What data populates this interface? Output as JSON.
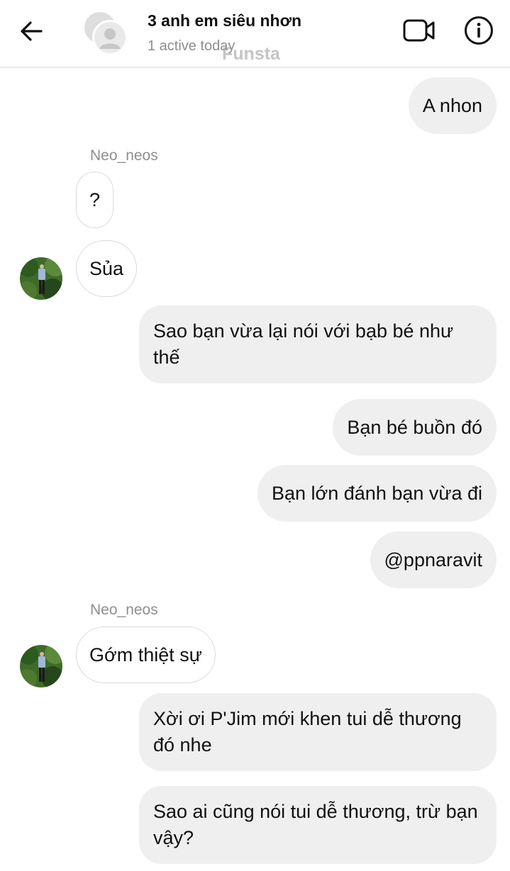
{
  "header": {
    "title": "3 anh em siêu nhơn",
    "status": "1 active today",
    "watermark": "Funsta",
    "icons": {
      "back": "arrow-left-icon",
      "video": "video-camera-icon",
      "info": "info-circle-icon"
    }
  },
  "messages": [
    {
      "direction": "outgoing",
      "text": "A nhon"
    },
    {
      "direction": "incoming",
      "sender": "Neo_neos",
      "text": "?"
    },
    {
      "direction": "incoming",
      "text": "Sủa",
      "avatar": "user-photo"
    },
    {
      "direction": "outgoing",
      "text": "Sao bạn vừa lại nói với bạb bé như thế"
    },
    {
      "direction": "outgoing",
      "text": "Bạn bé buồn đó"
    },
    {
      "direction": "outgoing",
      "text": "Bạn lớn đánh bạn vừa đi"
    },
    {
      "direction": "outgoing",
      "text": "@ppnaravit"
    },
    {
      "direction": "incoming",
      "sender": "Neo_neos",
      "text": "Gớm thiệt sự",
      "avatar": "user-photo"
    },
    {
      "direction": "outgoing",
      "text": "Xời ơi P'Jim mới khen tui dễ thương đó nhe"
    },
    {
      "direction": "outgoing",
      "text": "Sao ai cũng nói tui dễ thương, trừ bạn vậy?"
    }
  ],
  "colors": {
    "outgoing_bubble": "#efefef",
    "incoming_border": "#dbdbdb",
    "secondary_text": "#8e8e8e"
  }
}
